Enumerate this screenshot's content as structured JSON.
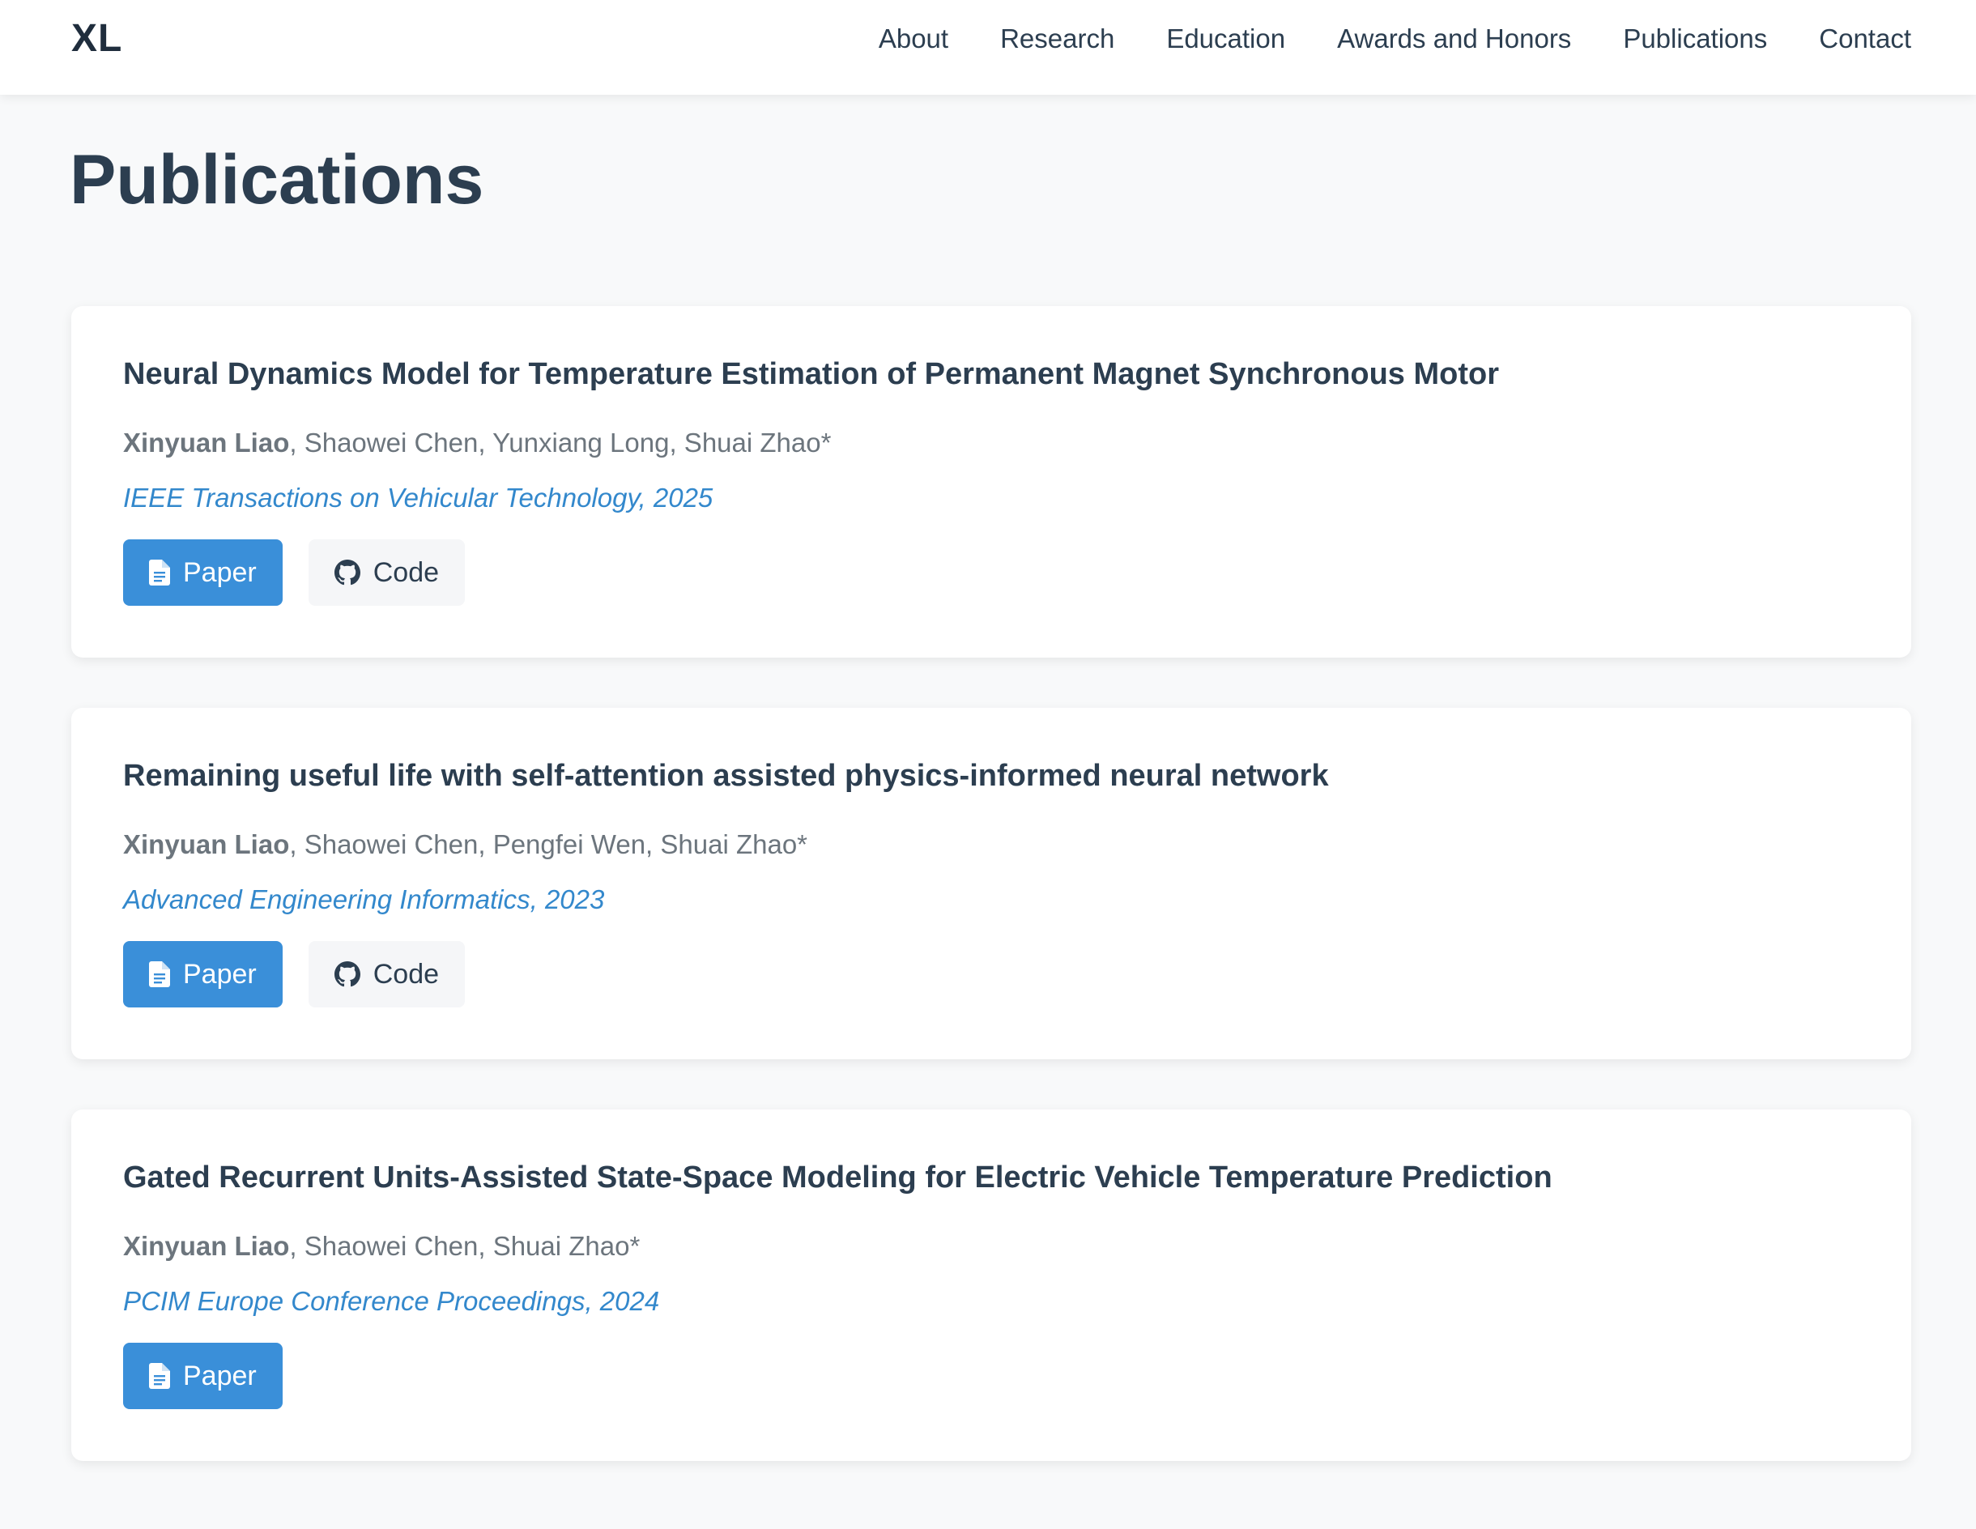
{
  "nav": {
    "brand": "XL",
    "links": [
      "About",
      "Research",
      "Education",
      "Awards and Honors",
      "Publications",
      "Contact"
    ]
  },
  "page": {
    "title": "Publications"
  },
  "publications": [
    {
      "title": "Neural Dynamics Model for Temperature Estimation of Permanent Magnet Synchronous Motor",
      "self_author": "Xinyuan Liao",
      "other_authors": ", Shaowei Chen, Yunxiang Long, Shuai Zhao*",
      "venue": "IEEE Transactions on Vehicular Technology, 2025",
      "paper_label": "Paper",
      "code_label": "Code"
    },
    {
      "title": "Remaining useful life with self-attention assisted physics-informed neural network",
      "self_author": "Xinyuan Liao",
      "other_authors": ", Shaowei Chen, Pengfei Wen, Shuai Zhao*",
      "venue": "Advanced Engineering Informatics, 2023",
      "paper_label": "Paper",
      "code_label": "Code"
    },
    {
      "title": "Gated Recurrent Units-Assisted State-Space Modeling for Electric Vehicle Temperature Prediction",
      "self_author": "Xinyuan Liao",
      "other_authors": ", Shaowei Chen, Shuai Zhao*",
      "venue": "PCIM Europe Conference Proceedings, 2024",
      "paper_label": "Paper"
    }
  ],
  "icons": {
    "paper": "file-text-icon",
    "code": "github-icon"
  },
  "colors": {
    "accent": "#3a8fd9",
    "venue": "#3388cc",
    "heading": "#2c3e50",
    "muted": "#6c757d",
    "background": "#f8f9fa"
  }
}
